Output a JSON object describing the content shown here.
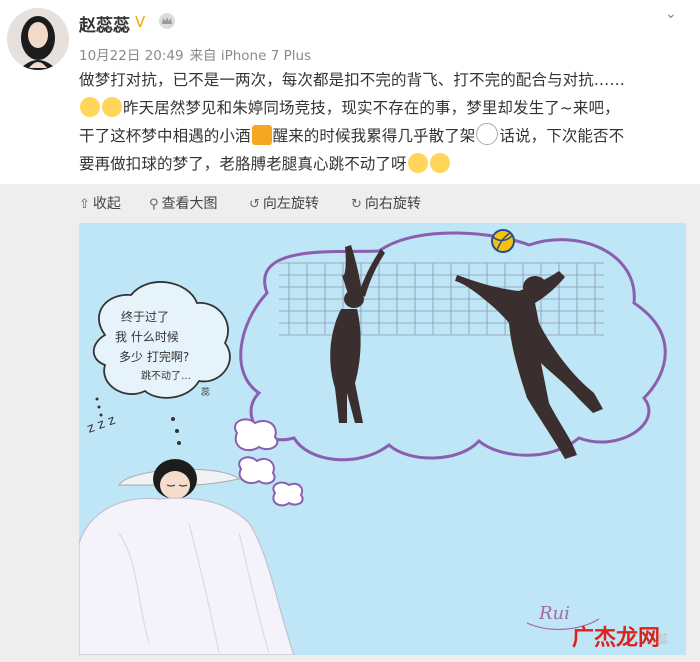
{
  "user": {
    "name": "赵蕊蕊",
    "vip_mark": "V",
    "timestamp": "10月22日 20:49",
    "source": "来自 iPhone 7 Plus"
  },
  "post": {
    "line1": "做梦打对抗，已不是一两次，每次都是扣不完的背飞、打不完的配合与对抗……",
    "line2": "昨天居然梦见和朱婷同场竞技，现实不存在的事，梦里却发生了~来吧，",
    "line3a": "干了这杯梦中相遇的小酒",
    "line3b": "醒来的时候我累得几乎散了架",
    "line3c": "话说，下次能否不",
    "line4": "要再做扣球的梦了，老胳膊老腿真心跳不动了呀"
  },
  "toolbar": {
    "collapse": "收起",
    "view_large": "查看大图",
    "rotate_left": "向左旋转",
    "rotate_right": "向右旋转"
  },
  "image": {
    "speech_text_1": "终于过了",
    "speech_text_2": "我 什么时候",
    "speech_text_3": "多少 打完啊?",
    "speech_text_4": "跳不动了…",
    "speech_text_5": "蕊",
    "zzz": "z z z",
    "signature": "Rui"
  },
  "watermark": {
    "site": "广杰龙网",
    "sub": "蕊"
  }
}
